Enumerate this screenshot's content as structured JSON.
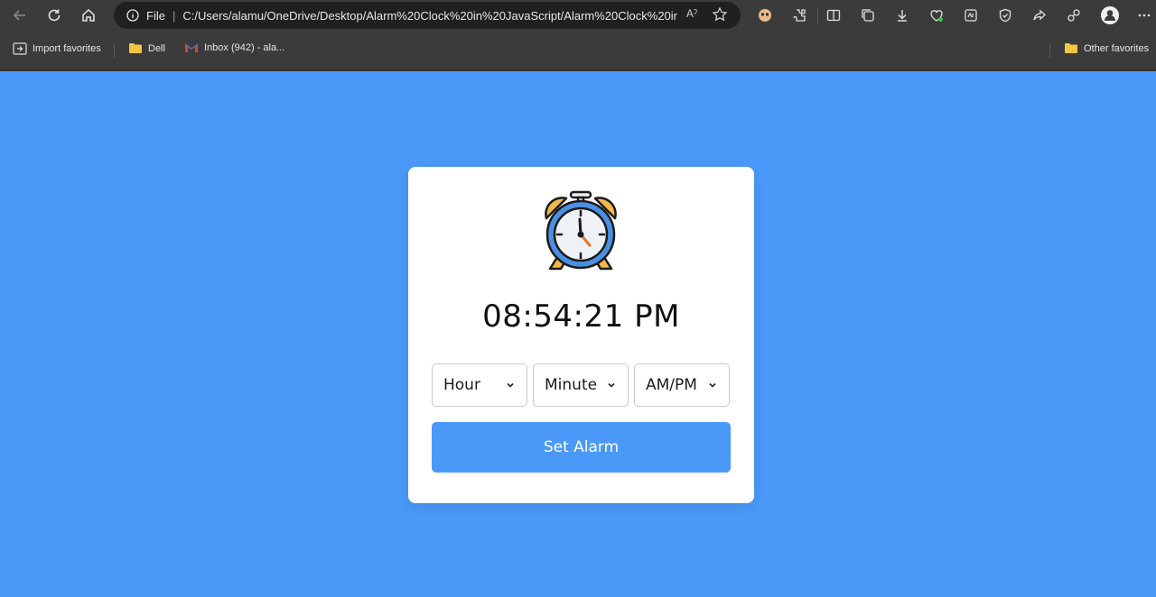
{
  "browser": {
    "address_scheme": "File",
    "address_url": "C:/Users/alamu/OneDrive/Desktop/Alarm%20Clock%20in%20JavaScript/Alarm%20Clock%20in%20J...",
    "read_aloud_label": "Aˀ",
    "favorites": [
      {
        "label": "Import favorites",
        "icon": "import-favorites-icon"
      },
      {
        "label": "Dell",
        "icon": "folder-icon"
      },
      {
        "label": "Inbox (942) - ala...",
        "icon": "gmail-icon"
      }
    ],
    "other_favorites": "Other favorites"
  },
  "app": {
    "current_time": "08:54:21 PM",
    "hour_placeholder": "Hour",
    "minute_placeholder": "Minute",
    "ampm_placeholder": "AM/PM",
    "set_alarm_label": "Set Alarm",
    "accent_color": "#4a99f8",
    "card_color": "#ffffff"
  }
}
